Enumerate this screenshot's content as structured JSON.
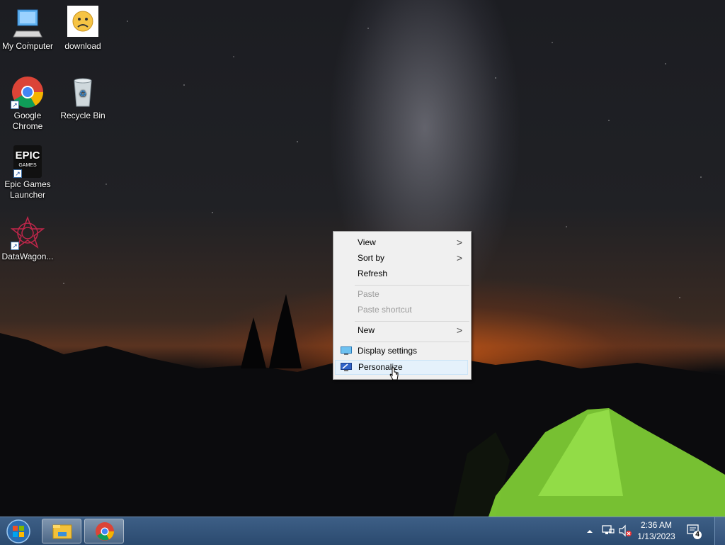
{
  "desktop": {
    "icons": [
      {
        "label": "My Computer",
        "icon": "my-computer-icon"
      },
      {
        "label": "download",
        "icon": "sad-face-icon"
      },
      {
        "label": "Google Chrome",
        "icon": "chrome-icon"
      },
      {
        "label": "Recycle Bin",
        "icon": "recycle-bin-icon"
      },
      {
        "label": "Epic Games Launcher",
        "icon": "epic-games-icon"
      },
      {
        "label": "DataWagon...",
        "icon": "datawagon-icon"
      }
    ],
    "epic_logo_text": "EPIC",
    "epic_logo_sub": "GAMES"
  },
  "context_menu": {
    "items": [
      {
        "label": "View"
      },
      {
        "label": "Sort by"
      },
      {
        "label": "Refresh"
      },
      {
        "label": "Paste"
      },
      {
        "label": "Paste shortcut"
      },
      {
        "label": "New"
      },
      {
        "label": "Display settings"
      },
      {
        "label": "Personalize"
      }
    ],
    "submenu_arrow": ">"
  },
  "taskbar": {
    "time": "2:36 AM",
    "date": "1/13/2023",
    "notification_count": "4",
    "pinned": [
      "file-explorer-icon",
      "chrome-icon"
    ],
    "tray_icons": [
      "show-hidden-icons-chevron",
      "network-icon",
      "volume-muted-icon",
      "notification-icon"
    ]
  },
  "colors": {
    "menu_bg": "#f0f0f0",
    "menu_hover": "#e5f1fb",
    "taskbar": "#2b4a6f",
    "tent_green": "#8be03a"
  }
}
